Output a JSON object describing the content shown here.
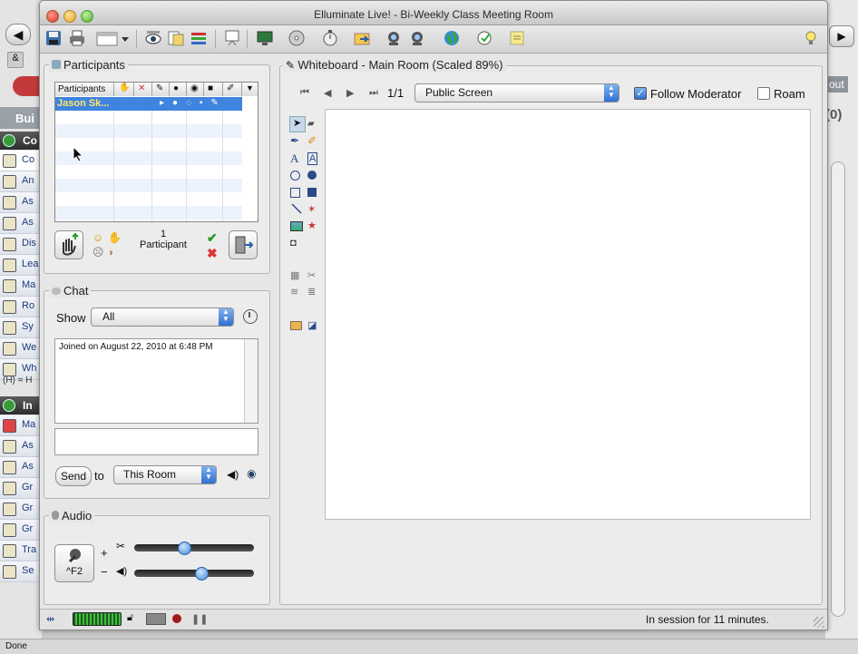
{
  "window": {
    "title": "Elluminate Live! - Bi-Weekly Class Meeting Room"
  },
  "background_browser": {
    "nav_items": [
      "Bui",
      "Co",
      "Co",
      "An",
      "As",
      "As",
      "Dis",
      "Lea",
      "Ma",
      "Ro",
      "Sy",
      "We",
      "Wh",
      "(H) = H",
      "In",
      "Ma",
      "As",
      "As",
      "Gr",
      "Gr",
      "Gr",
      "Tra",
      "Se"
    ],
    "right_text_1": "out",
    "right_text_2": "(0)",
    "status": "Done"
  },
  "participants": {
    "title": "Participants",
    "header_label": "Participants",
    "rows": [
      "Jason Sk..."
    ],
    "count": "1",
    "count_label": "Participant"
  },
  "chat": {
    "title": "Chat",
    "show_label": "Show",
    "show_value": "All",
    "messages": [
      "Joined on August 22, 2010 at 6:48 PM"
    ],
    "send_label": "Send",
    "to_label": "to",
    "to_value": "This Room"
  },
  "audio": {
    "title": "Audio",
    "talk_shortcut": "^F2",
    "plus": "+",
    "minus": "−",
    "mic_level": 0.4,
    "speaker_level": 0.56
  },
  "whiteboard": {
    "title": "Whiteboard - Main Room (Scaled 89%)",
    "page": "1/1",
    "screen_value": "Public Screen",
    "follow_label": "Follow Moderator",
    "follow_checked": true,
    "roam_label": "Roam",
    "roam_checked": false
  },
  "status": {
    "session_text": "In session for 11 minutes."
  },
  "colors": {
    "selection": "#3f84de",
    "accent": "#2f6fd0"
  }
}
